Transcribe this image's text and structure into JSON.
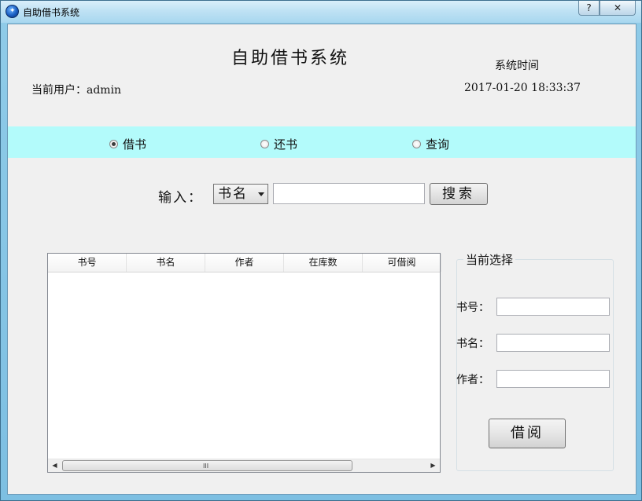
{
  "window": {
    "title": "自助借书系统",
    "help_label": "?",
    "close_label": "✕"
  },
  "header": {
    "title": "自助借书系统",
    "system_time_label": "系统时间",
    "current_user": "当前用户：admin",
    "time_value": "2017-01-20 18:33:37"
  },
  "modes": {
    "selected": "借书",
    "options": [
      "借书",
      "还书",
      "查询"
    ]
  },
  "search": {
    "label": "输入：",
    "field_select": "书名",
    "value": "",
    "button_label": "搜索"
  },
  "table": {
    "columns": [
      "书号",
      "书名",
      "作者",
      "在库数",
      "可借阅"
    ],
    "rows": [],
    "scroll_grip": "III"
  },
  "selection": {
    "group_title": "当前选择",
    "book_id_label": "书号：",
    "book_name_label": "书名：",
    "author_label": "作者：",
    "book_id": "",
    "book_name": "",
    "author": "",
    "borrow_button": "借阅"
  },
  "colors": {
    "mode_bar": "#b3fbfb",
    "client_bg": "#f0f0f0"
  }
}
